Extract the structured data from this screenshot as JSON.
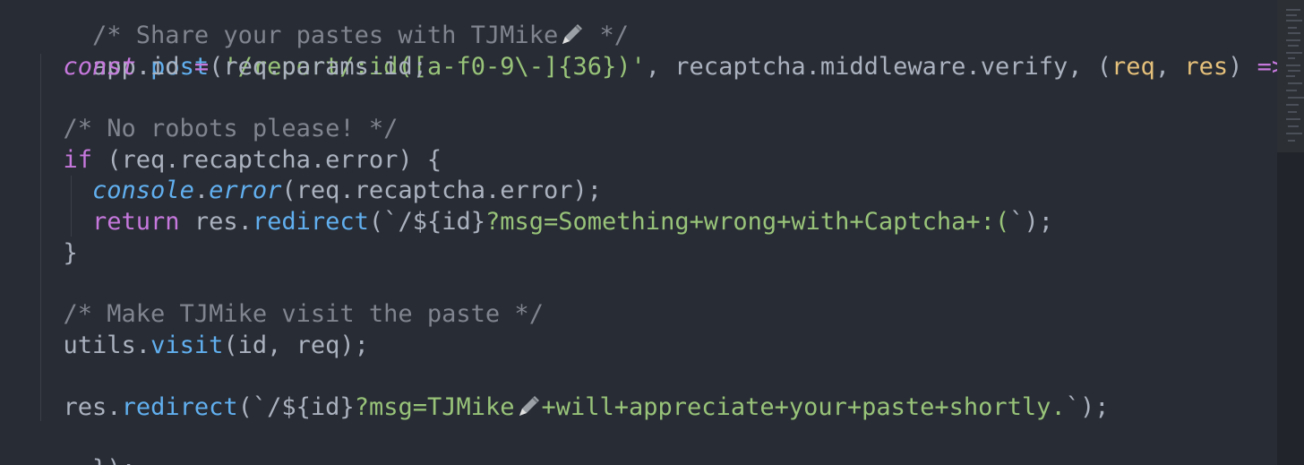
{
  "code": {
    "line1": {
      "comment_start": "/* Share your pastes with TJMike",
      "comment_end": " */"
    },
    "line2": {
      "obj": "app",
      "dot": ".",
      "method": "post",
      "open_paren": "(",
      "route_string": "'/report/:id([a-f0-9\\-]{36})'",
      "comma1": ", ",
      "middleware": "recaptcha",
      "dot2": ".",
      "middleware_prop": "middleware",
      "dot3": ".",
      "middleware_fn": "verify",
      "comma2": ", ",
      "args_open": "(",
      "param_req": "req",
      "args_comma": ", ",
      "param_res": "res",
      "args_close": ") ",
      "arrow": "=>",
      "brace_open": " {"
    },
    "line3": {
      "keyword": "const",
      "var_name": " id ",
      "assign": "=",
      "value": " req.params.id;"
    },
    "line5": {
      "comment": "/* No robots please! */"
    },
    "line6": {
      "keyword": "if",
      "condition": " (req.recaptcha.error) {"
    },
    "line7": {
      "console": "console",
      "dot": ".",
      "error_fn": "error",
      "args": "(req.recaptcha.error);"
    },
    "line8": {
      "keyword": "return",
      "obj": " res",
      "dot": ".",
      "fn": "redirect",
      "open": "(",
      "tick_open": "`",
      "path": "/",
      "interp": "${id}",
      "msg": "?msg=Something+wrong+with+Captcha+:(",
      "tick_close": "`",
      "close": ");"
    },
    "line9": {
      "brace": "}"
    },
    "line11": {
      "comment": "/* Make TJMike visit the paste */"
    },
    "line12": {
      "obj": "utils",
      "dot": ".",
      "fn": "visit",
      "args": "(id, req);"
    },
    "line14": {
      "obj": "res",
      "dot": ".",
      "fn": "redirect",
      "open": "(",
      "tick_open": "`",
      "path": "/",
      "interp": "${id}",
      "msg_start": "?msg=TJMike",
      "msg_end": "+will+appreciate+your+paste+shortly.",
      "tick_close": "`",
      "close": ");"
    },
    "line15": {
      "close": "});"
    }
  },
  "icons": {
    "pencil": "pencil-emoji-icon"
  },
  "colors": {
    "background": "#282c34",
    "comment": "#7f848e",
    "keyword": "#c678dd",
    "function": "#61afef",
    "string": "#98c379",
    "parameter": "#e5c07b",
    "operator": "#56b6c2",
    "plain": "#abb2bf"
  }
}
